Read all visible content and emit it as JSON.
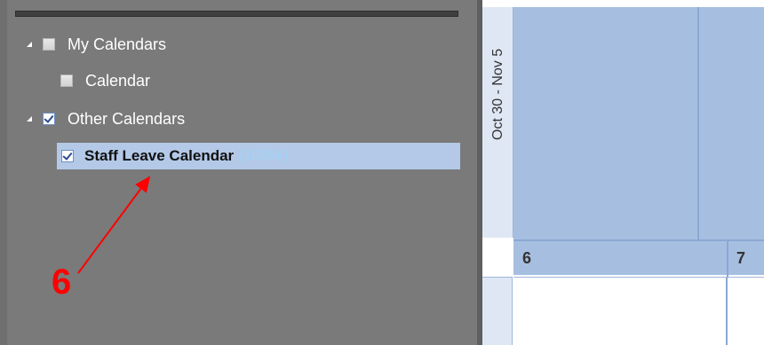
{
  "navigation": {
    "my_calendars": {
      "label": "My Calendars",
      "checked": false,
      "expanded": true
    },
    "calendar": {
      "label": "Calendar",
      "checked": false
    },
    "other_calendars": {
      "label": "Other Calendars",
      "checked": true,
      "expanded": true
    },
    "staff_leave": {
      "label": "Staff Leave Calendar",
      "count": "(10364)",
      "checked": true,
      "selected": true
    }
  },
  "annotation": {
    "number": "6",
    "color": "#ff0000"
  },
  "calendar_view": {
    "week_label": "Oct 30 - Nov 5",
    "dates": [
      "6",
      "7"
    ],
    "colors": {
      "week_fill": "#a6bfe0",
      "selected_row": "#b3c9e7",
      "pane_bg": "#7a7a7a"
    }
  }
}
